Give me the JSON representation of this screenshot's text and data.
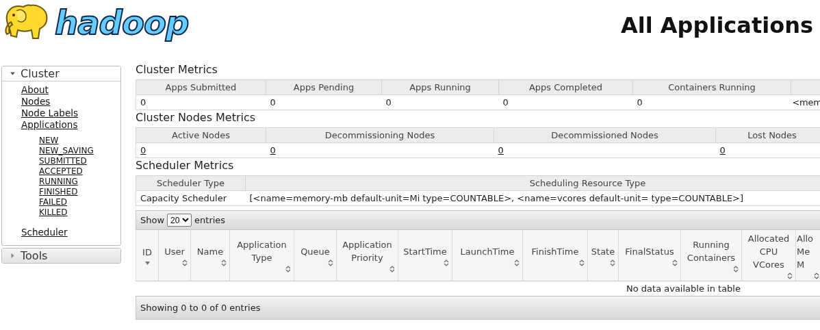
{
  "header": {
    "logo_text": "hadoop",
    "title": "All Applications"
  },
  "sidebar": [
    {
      "label": "Cluster",
      "expanded": true,
      "items": [
        {
          "label": "About"
        },
        {
          "label": "Nodes"
        },
        {
          "label": "Node Labels"
        },
        {
          "label": "Applications",
          "children": [
            {
              "label": "NEW"
            },
            {
              "label": "NEW_SAVING"
            },
            {
              "label": "SUBMITTED"
            },
            {
              "label": "ACCEPTED"
            },
            {
              "label": "RUNNING"
            },
            {
              "label": "FINISHED"
            },
            {
              "label": "FAILED"
            },
            {
              "label": "KILLED"
            }
          ]
        },
        {
          "label": "Scheduler"
        }
      ]
    },
    {
      "label": "Tools",
      "expanded": false
    }
  ],
  "metrics": [
    {
      "title": "Cluster Metrics",
      "links": false,
      "columns": [
        "Apps Submitted",
        "Apps Pending",
        "Apps Running",
        "Apps Completed",
        "Containers Running",
        ""
      ],
      "values": [
        "0",
        "0",
        "0",
        "0",
        "0",
        "<mem"
      ]
    },
    {
      "title": "Cluster Nodes Metrics",
      "links": true,
      "columns": [
        "Active Nodes",
        "Decommissioning Nodes",
        "Decommissioned Nodes",
        "Lost Nodes"
      ],
      "values": [
        "0",
        "0",
        "0",
        "0"
      ]
    },
    {
      "title": "Scheduler Metrics",
      "links": false,
      "columns": [
        "Scheduler Type",
        "Scheduling Resource Type"
      ],
      "values": [
        "Capacity Scheduler",
        "[<name=memory-mb default-unit=Mi type=COUNTABLE>, <name=vcores default-unit= type=COUNTABLE>]"
      ]
    }
  ],
  "apps_table": {
    "show_label": "Show",
    "page_size": "20",
    "entries_label": "entries",
    "columns": [
      {
        "label": "ID",
        "sorted": true
      },
      {
        "label": "User",
        "sorted": false
      },
      {
        "label": "Name",
        "sorted": false
      },
      {
        "label": "Application\nType",
        "sorted": false
      },
      {
        "label": "Queue",
        "sorted": false
      },
      {
        "label": "Application\nPriority",
        "sorted": false
      },
      {
        "label": "StartTime",
        "sorted": false
      },
      {
        "label": "LaunchTime",
        "sorted": false
      },
      {
        "label": "FinishTime",
        "sorted": false
      },
      {
        "label": "State",
        "sorted": false
      },
      {
        "label": "FinalStatus",
        "sorted": false
      },
      {
        "label": "Running\nContainers",
        "sorted": false
      },
      {
        "label": "Allocated\nCPU\nVCores",
        "sorted": false
      },
      {
        "label": "Allo\nMe\nM",
        "sorted": false
      }
    ],
    "empty_message": "No data available in table",
    "info": "Showing 0 to 0 of 0 entries"
  }
}
